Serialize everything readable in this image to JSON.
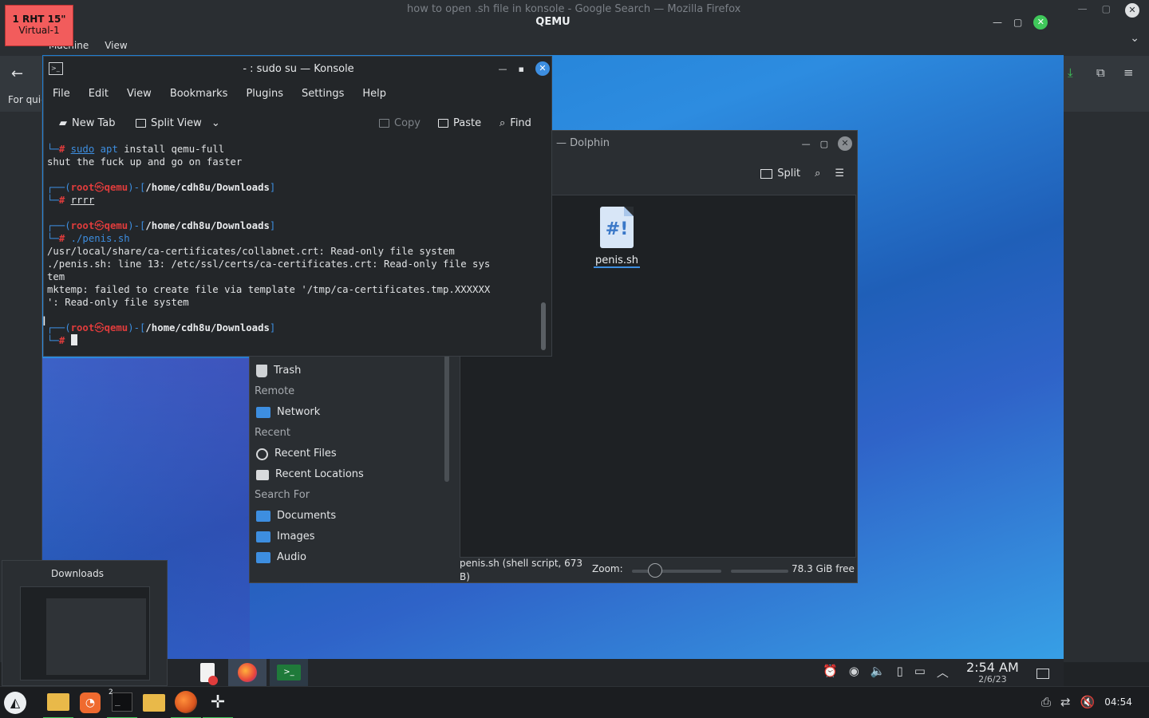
{
  "host": {
    "firefox_title": "how to open .sh file in konsole - Google Search — Mozilla Firefox",
    "back_arrow": "←",
    "for_quick_text": "For quic",
    "right_icons": [
      "download-icon",
      "extensions-icon",
      "hamburger-menu-icon"
    ]
  },
  "vm_label": {
    "line1": "1 RHT 15\"",
    "line2": "Virtual-1"
  },
  "qemu": {
    "title": "QEMU",
    "menu": [
      "Machine",
      "View"
    ]
  },
  "konsole": {
    "title": "- : sudo su — Konsole",
    "menu": [
      "File",
      "Edit",
      "View",
      "Bookmarks",
      "Plugins",
      "Settings",
      "Help"
    ],
    "toolbar": {
      "new_tab": "New Tab",
      "split_view": "Split View",
      "copy": "Copy",
      "paste": "Paste",
      "find": "Find"
    },
    "terminal": {
      "l1_cmd_sudo": "sudo",
      "l1_cmd_apt": "apt",
      "l1_cmd_rest": " install qemu-full",
      "l2": "shut the fuck up and go on faster",
      "prompt_user": "root",
      "prompt_host": "qemu",
      "prompt_path": "/home/cdh8u/Downloads",
      "cmd2": "rrrr",
      "cmd3": "./penis.sh",
      "out1": "/usr/local/share/ca-certificates/collabnet.crt: Read-only file system",
      "out2": "./penis.sh: line 13: /etc/ssl/certs/ca-certificates.crt: Read-only file sys",
      "out3": "tem",
      "out4": "mktemp: failed to create file via template '/tmp/ca-certificates.tmp.XXXXXX",
      "out5": "': Read-only file system"
    }
  },
  "dolphin": {
    "title": "— Dolphin",
    "toolbar": {
      "split": "Split"
    },
    "file": {
      "name": "penis.sh",
      "icon_text": "#!"
    },
    "sidebar": {
      "trash": "Trash",
      "remote_head": "Remote",
      "network": "Network",
      "recent_head": "Recent",
      "recent_files": "Recent Files",
      "recent_locations": "Recent Locations",
      "search_head": "Search For",
      "documents": "Documents",
      "images": "Images",
      "audio": "Audio"
    },
    "status": {
      "file_info": "penis.sh (shell script, 673 B)",
      "zoom_label": "Zoom:",
      "free_space": "78.3 GiB free"
    }
  },
  "guest_taskbar": {
    "time": "2:54 AM",
    "date": "2/6/23"
  },
  "thumbnail": {
    "title": "Downloads"
  },
  "host_taskbar": {
    "terminal_badge": "2",
    "clock": "04:54"
  },
  "colors": {
    "accent": "#3d8ee0",
    "prompt_red": "#e03c3c",
    "qemu_close": "#3fc85a",
    "vm_label_bg": "#f25c5c"
  }
}
